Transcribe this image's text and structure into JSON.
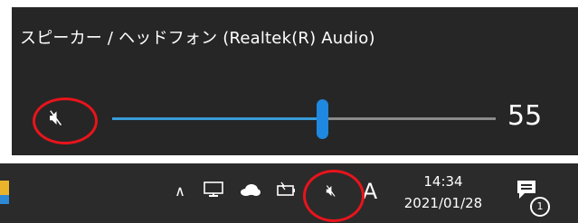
{
  "flyout": {
    "device_name": "スピーカー / ヘッドフォン (Realtek(R) Audio)",
    "volume_value": "55",
    "volume_level_percent": 55,
    "mute_icon": "speaker-muted-icon"
  },
  "taskbar": {
    "time": "14:34",
    "date": "2021/01/28",
    "notification_count": "1",
    "ime_indicator": "A",
    "icons": [
      "file-explorer-icon",
      "chevron-up-icon",
      "network-icon",
      "onedrive-cloud-icon",
      "power-icon",
      "speaker-muted-icon",
      "notification-center-icon"
    ]
  },
  "colors": {
    "flyout_background": "#262626",
    "taskbar_background": "#2b2b2b",
    "slider_accent": "#1f88e0",
    "highlight_circle": "#e8141b"
  }
}
